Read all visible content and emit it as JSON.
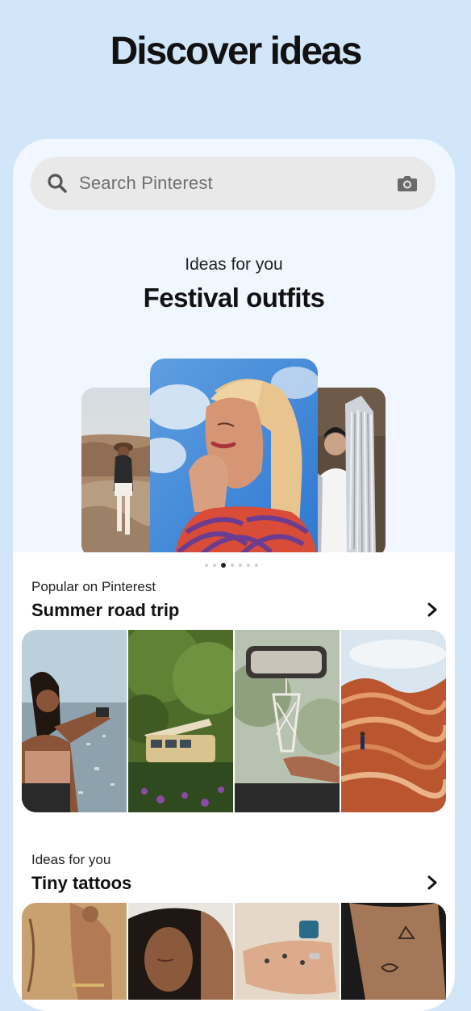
{
  "headline": "Discover ideas",
  "search": {
    "placeholder": "Search Pinterest"
  },
  "featured": {
    "subtitle": "Ideas for you",
    "title": "Festival outfits"
  },
  "carousel": {
    "total_dots": 7,
    "active_index": 2
  },
  "sections": [
    {
      "subtitle": "Popular on Pinterest",
      "title": "Summer road trip"
    },
    {
      "subtitle": "Ideas for you",
      "title": "Tiny tattoos"
    }
  ],
  "icons": [
    "search-icon",
    "camera-icon",
    "chevron-right-icon"
  ],
  "colors": {
    "page_bg": "#d2e6fa",
    "panel_bg": "#f1f7fe",
    "search_bg": "#e9e9e9"
  }
}
